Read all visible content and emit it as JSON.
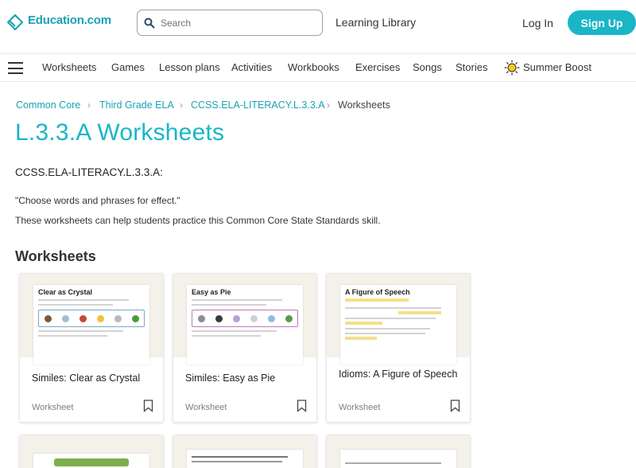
{
  "header": {
    "logo_text": "Education.com",
    "search_placeholder": "Search",
    "learning_library": "Learning Library",
    "login": "Log In",
    "signup": "Sign Up"
  },
  "nav": {
    "items": [
      "Worksheets",
      "Games",
      "Lesson plans",
      "Activities",
      "Workbooks",
      "Exercises",
      "Songs",
      "Stories"
    ],
    "summer_boost": "Summer Boost"
  },
  "breadcrumb": {
    "items": [
      "Common Core",
      "Third Grade ELA",
      "CCSS.ELA-LITERACY.L.3.3.A",
      "Worksheets"
    ],
    "separator": "›"
  },
  "page": {
    "title": "L.3.3.A Worksheets",
    "standard_code": "CCSS.ELA-LITERACY.L.3.3.A:",
    "quote": "\"Choose words and phrases for effect.\"",
    "description": "These worksheets can help students practice this Common Core State Standards skill.",
    "section_title": "Worksheets"
  },
  "cards": [
    {
      "thumb_title": "Clear as Crystal",
      "title": "Similes: Clear as Crystal",
      "type": "Worksheet"
    },
    {
      "thumb_title": "Easy as Pie",
      "title": "Similes: Easy as Pie",
      "type": "Worksheet"
    },
    {
      "thumb_title": "A Figure of Speech",
      "title": "Idioms: A Figure of Speech",
      "type": "Worksheet"
    }
  ],
  "colors": {
    "brand": "#1ab6c6",
    "link": "#1aa3b3"
  }
}
